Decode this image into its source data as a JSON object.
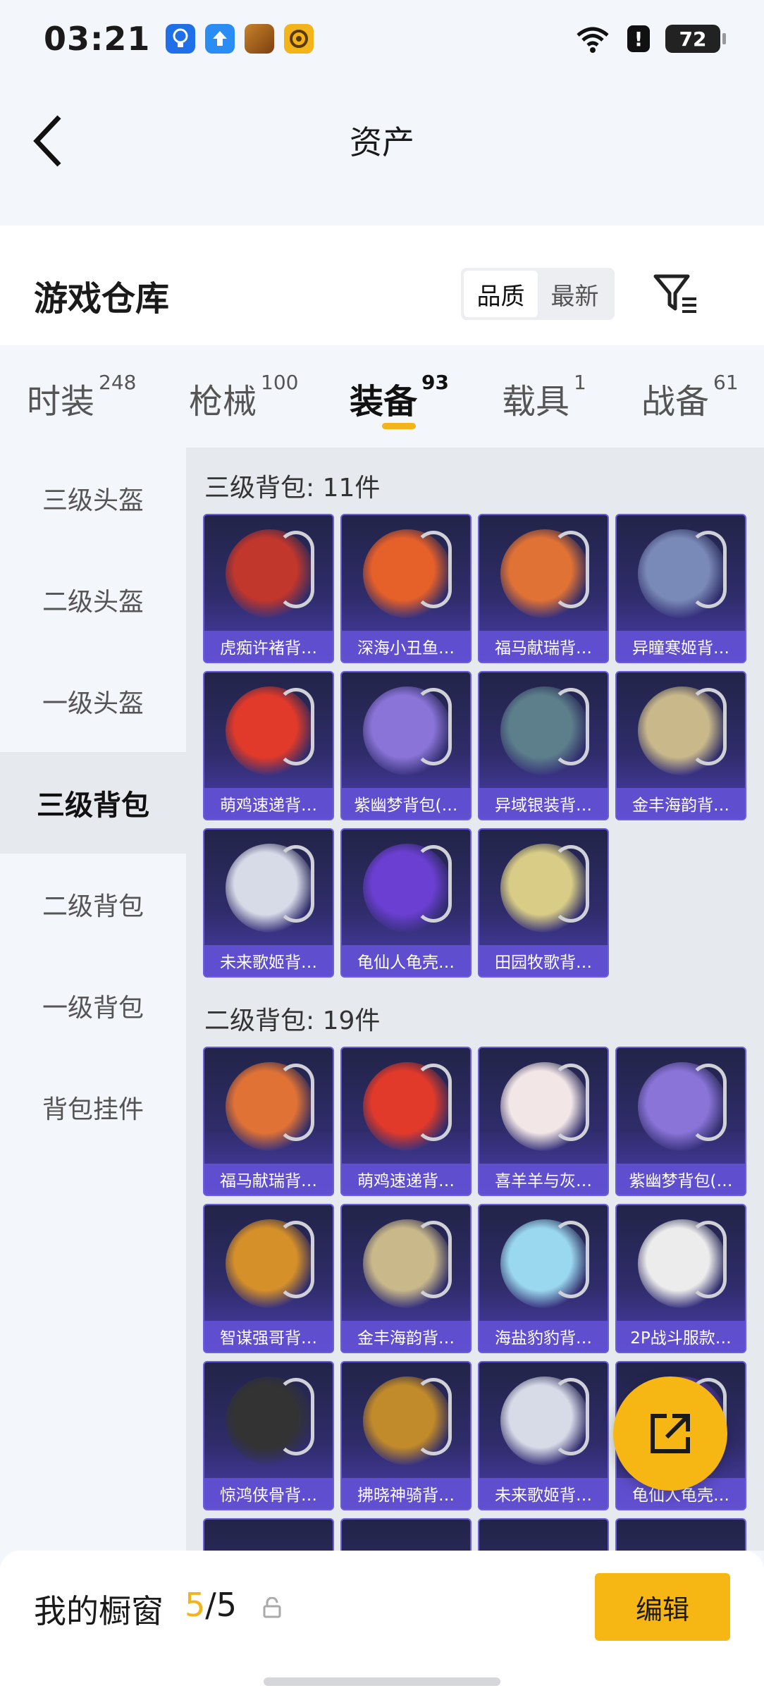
{
  "status_bar": {
    "time": "03:21",
    "battery": "72",
    "alert": "!"
  },
  "header": {
    "title": "资产"
  },
  "warehouse": {
    "title": "游戏仓库",
    "sort_options": [
      "品质",
      "最新"
    ]
  },
  "tabs": [
    {
      "label": "时装",
      "count": "248"
    },
    {
      "label": "枪械",
      "count": "100"
    },
    {
      "label": "装备",
      "count": "93"
    },
    {
      "label": "载具",
      "count": "1"
    },
    {
      "label": "战备",
      "count": "61"
    }
  ],
  "sidebar": [
    "三级头盔",
    "二级头盔",
    "一级头盔",
    "三级背包",
    "二级背包",
    "一级背包",
    "背包挂件"
  ],
  "sections": [
    {
      "title": "三级背包: 11件",
      "items": [
        "虎痴许褚背…",
        "深海小丑鱼…",
        "福马献瑞背…",
        "异瞳寒姬背…",
        "萌鸡速递背…",
        "紫幽梦背包(…",
        "异域银装背…",
        "金丰海韵背…",
        "未来歌姬背…",
        "龟仙人龟壳…",
        "田园牧歌背…"
      ]
    },
    {
      "title": "二级背包: 19件",
      "items": [
        "福马献瑞背…",
        "萌鸡速递背…",
        "喜羊羊与灰…",
        "紫幽梦背包(…",
        "智谋强哥背…",
        "金丰海韵背…",
        "海盐豹豹背…",
        "2P战斗服款…",
        "惊鸿侠骨背…",
        "拂晓神骑背…",
        "未来歌姬背…",
        "龟仙人龟壳…"
      ]
    }
  ],
  "bottom": {
    "label": "我的橱窗",
    "used": "5",
    "total": "/5",
    "edit": "编辑"
  }
}
